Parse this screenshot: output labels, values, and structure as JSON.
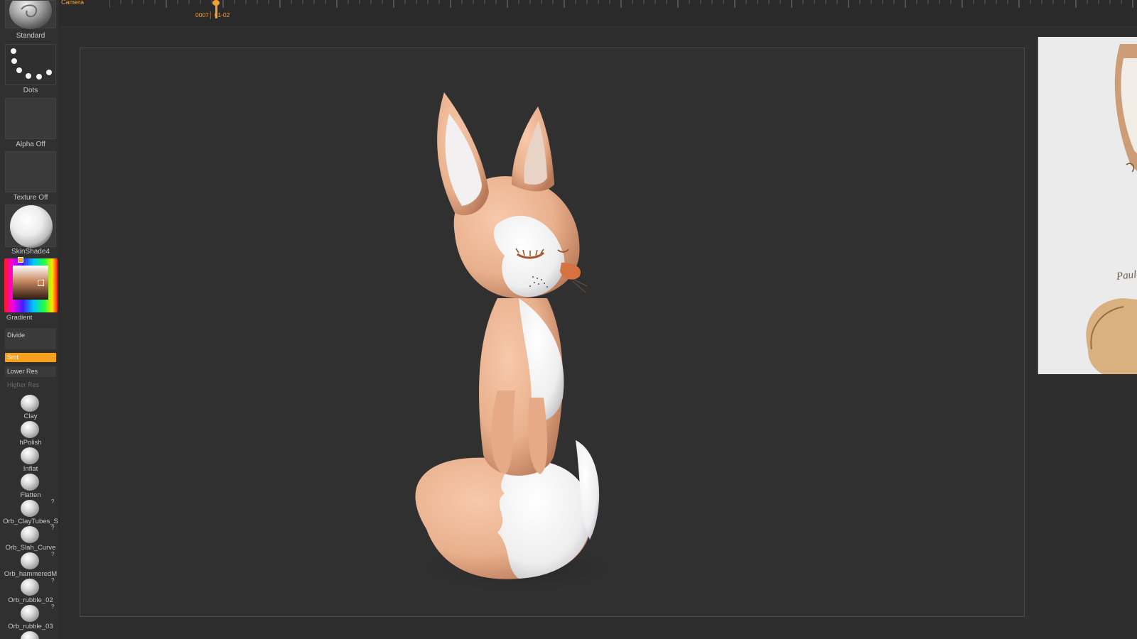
{
  "timeline": {
    "camera_label": "Camera",
    "frame_label": "0007│ 01-02"
  },
  "shelf": {
    "brush": {
      "label": "Standard",
      "icon": "standard-brush-icon"
    },
    "stroke": {
      "label": "Dots",
      "icon": "dots-stroke-icon"
    },
    "alpha": {
      "label": "Alpha Off"
    },
    "texture": {
      "label": "Texture Off"
    },
    "material": {
      "label": "SkinShade4"
    },
    "color": {
      "label": "Gradient",
      "hue_primary": "#f5a11e",
      "selected_color": "#c87a50"
    },
    "buttons": {
      "divide": "Divide",
      "smt": "Smt",
      "lower_res": "Lower Res",
      "higher_res": "Higher Res"
    },
    "brushes": [
      {
        "label": "Clay",
        "help": ""
      },
      {
        "label": "hPolish",
        "help": ""
      },
      {
        "label": "Inflat",
        "help": ""
      },
      {
        "label": "Flatten",
        "help": ""
      },
      {
        "label": "Orb_ClayTubes_S",
        "help": "?"
      },
      {
        "label": "Orb_Slah_Curve",
        "help": "?"
      },
      {
        "label": "Orb_hammeredM",
        "help": "?"
      },
      {
        "label": "Orb_rubble_02",
        "help": "?"
      },
      {
        "label": "Orb_rubble_03",
        "help": "?"
      }
    ]
  },
  "viewport": {
    "model": "fox sculpt",
    "colors": {
      "fur": "#eab08f",
      "white": "#f1f1f3",
      "nose": "#d5723f",
      "background": "#303030"
    }
  },
  "reference": {
    "signature": "Paula"
  }
}
